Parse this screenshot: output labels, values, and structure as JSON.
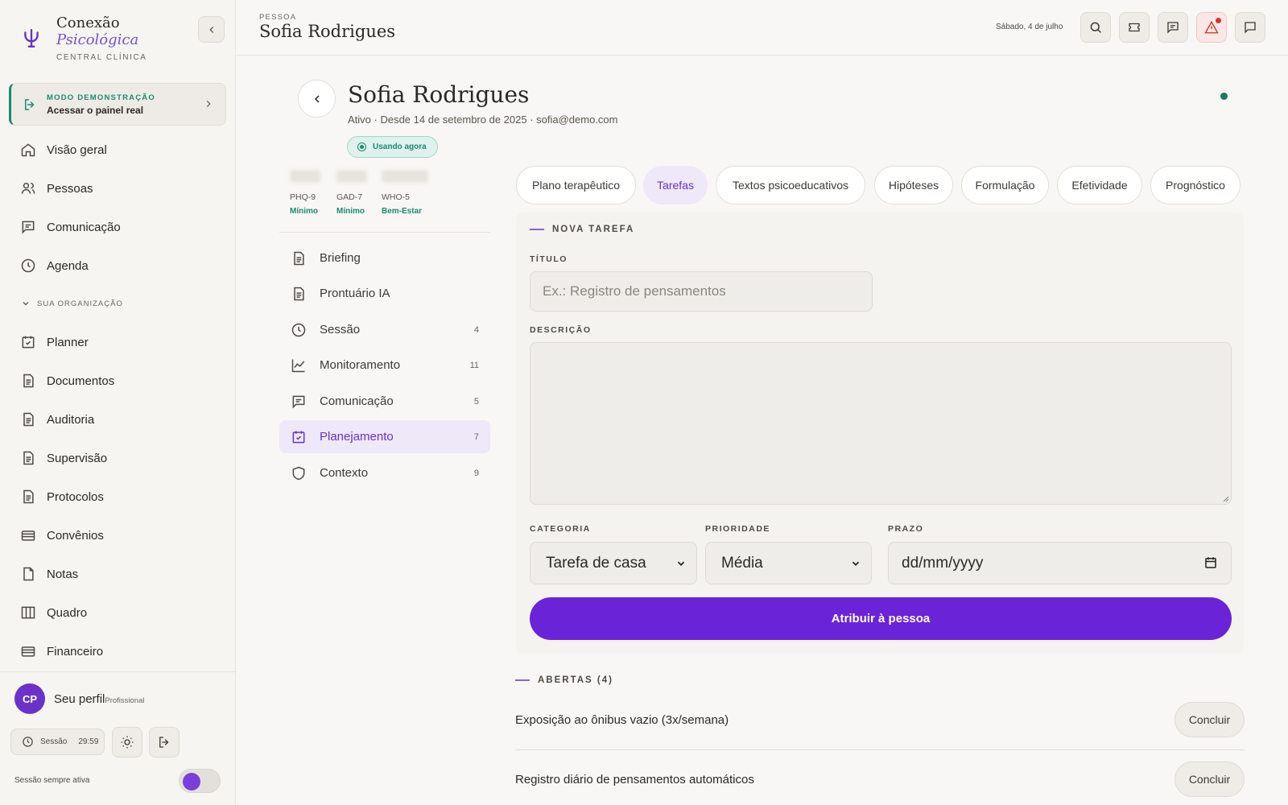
{
  "brand": {
    "line1": "Conexão",
    "line2": "Psicológica",
    "line3": "CENTRAL CLÍNICA"
  },
  "demo": {
    "label": "MODO DEMONSTRAÇÃO",
    "action": "Acessar o painel real"
  },
  "sidebar": {
    "main": [
      {
        "label": "Visão geral",
        "icon": "home-icon"
      },
      {
        "label": "Pessoas",
        "icon": "users-icon"
      },
      {
        "label": "Comunicação",
        "icon": "message-icon"
      },
      {
        "label": "Agenda",
        "icon": "clock-icon"
      }
    ],
    "org_heading": "SUA ORGANIZAÇÃO",
    "org": [
      {
        "label": "Planner",
        "icon": "calendar-check-icon"
      },
      {
        "label": "Documentos",
        "icon": "document-icon"
      },
      {
        "label": "Auditoria",
        "icon": "document-icon"
      },
      {
        "label": "Supervisão",
        "icon": "document-icon"
      },
      {
        "label": "Protocolos",
        "icon": "document-icon"
      },
      {
        "label": "Convênios",
        "icon": "card-icon"
      },
      {
        "label": "Notas",
        "icon": "note-icon"
      },
      {
        "label": "Quadro",
        "icon": "columns-icon"
      },
      {
        "label": "Financeiro",
        "icon": "card-icon"
      }
    ]
  },
  "profile": {
    "initials": "CP",
    "name": "Seu perfil",
    "role": "Profissional"
  },
  "session": {
    "label": "Sessão",
    "timer": "29:59",
    "always_label": "Sessão sempre ativa",
    "always_on": true
  },
  "topbar": {
    "crumb": "PESSOA",
    "title": "Sofia Rodrigues",
    "date": "Sábado, 4 de julho"
  },
  "person": {
    "name": "Sofia Rodrigues",
    "meta": "Ativo · Desde 14 de setembro de 2025 · sofia@demo.com",
    "status_badge": "Usando agora"
  },
  "scores": [
    {
      "name": "PHQ-9",
      "level": "Mínimo"
    },
    {
      "name": "GAD-7",
      "level": "Mínimo"
    },
    {
      "name": "WHO-5",
      "level": "Bem-Estar"
    }
  ],
  "subnav": [
    {
      "label": "Briefing",
      "count": "",
      "icon": "document-icon"
    },
    {
      "label": "Prontuário IA",
      "count": "",
      "icon": "document-icon"
    },
    {
      "label": "Sessão",
      "count": "4",
      "icon": "clock-icon"
    },
    {
      "label": "Monitoramento",
      "count": "11",
      "icon": "chart-line-icon"
    },
    {
      "label": "Comunicação",
      "count": "5",
      "icon": "message-icon"
    },
    {
      "label": "Planejamento",
      "count": "7",
      "icon": "calendar-check-icon",
      "active": true
    },
    {
      "label": "Contexto",
      "count": "9",
      "icon": "shield-icon"
    }
  ],
  "tabs": [
    "Plano terapêutico",
    "Tarefas",
    "Textos psicoeducativos",
    "Hipóteses",
    "Formulação",
    "Efetividade",
    "Prognóstico"
  ],
  "active_tab": "Tarefas",
  "form": {
    "heading": "NOVA TAREFA",
    "title_label": "TÍTULO",
    "title_placeholder": "Ex.: Registro de pensamentos",
    "description_label": "DESCRIÇÃO",
    "category_label": "CATEGORIA",
    "category_value": "Tarefa de casa",
    "priority_label": "PRIORIDADE",
    "priority_value": "Média",
    "deadline_label": "PRAZO",
    "deadline_placeholder": "dd/mm/yyyy",
    "submit": "Atribuir à pessoa"
  },
  "open_tasks": {
    "heading": "ABERTAS (4)",
    "action": "Concluir",
    "items": [
      "Exposição ao ônibus vazio (3x/semana)",
      "Registro diário de pensamentos automáticos"
    ]
  },
  "colors": {
    "accent": "#6a23d7",
    "teal": "#1a8a73",
    "alert": "#d9362b"
  }
}
